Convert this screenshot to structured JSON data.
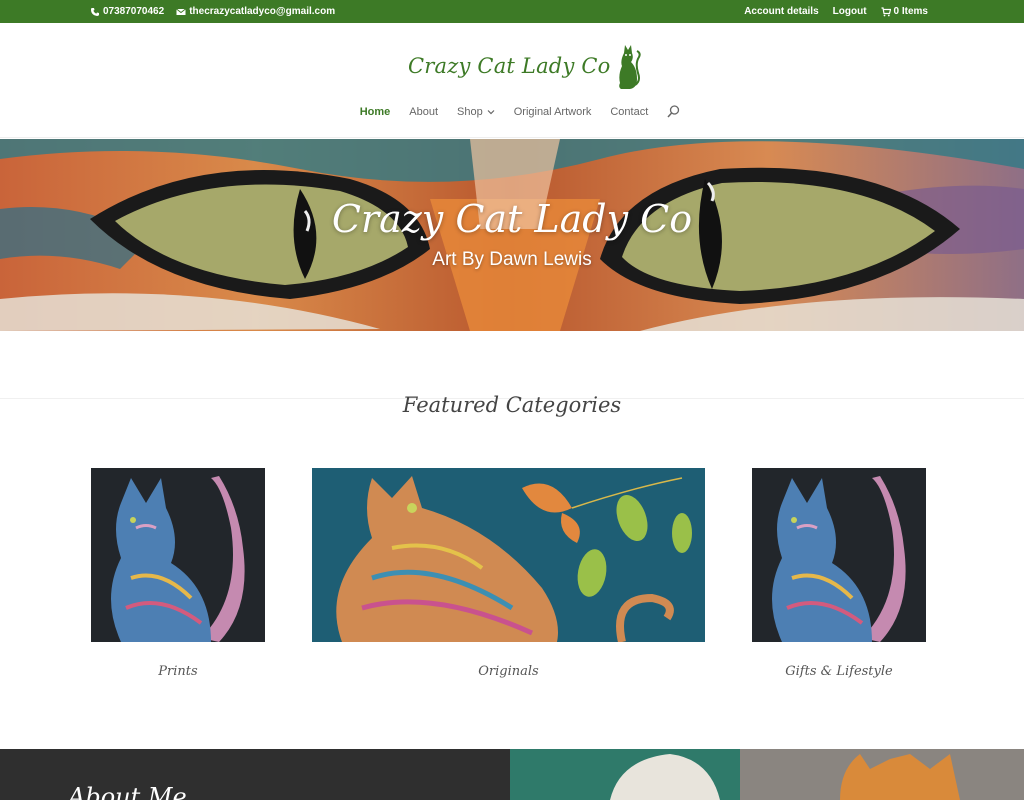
{
  "topbar": {
    "phone": "07387070462",
    "email": "thecrazycatladyco@gmail.com",
    "account": "Account details",
    "logout": "Logout",
    "cart": "0 Items"
  },
  "header": {
    "logo_text": "Crazy Cat Lady Co",
    "nav": {
      "home": "Home",
      "about": "About",
      "shop": "Shop",
      "original_artwork": "Original Artwork",
      "contact": "Contact"
    }
  },
  "hero": {
    "title": "Crazy Cat Lady Co",
    "subtitle": "Art By Dawn Lewis"
  },
  "featured": {
    "heading": "Featured Categories",
    "categories": [
      {
        "label": "Prints"
      },
      {
        "label": "Originals"
      },
      {
        "label": "Gifts & Lifestyle"
      }
    ]
  },
  "about": {
    "title": "About Me"
  },
  "colors": {
    "brand_green": "#3d7a26",
    "dark_section": "#2f2f2f"
  }
}
